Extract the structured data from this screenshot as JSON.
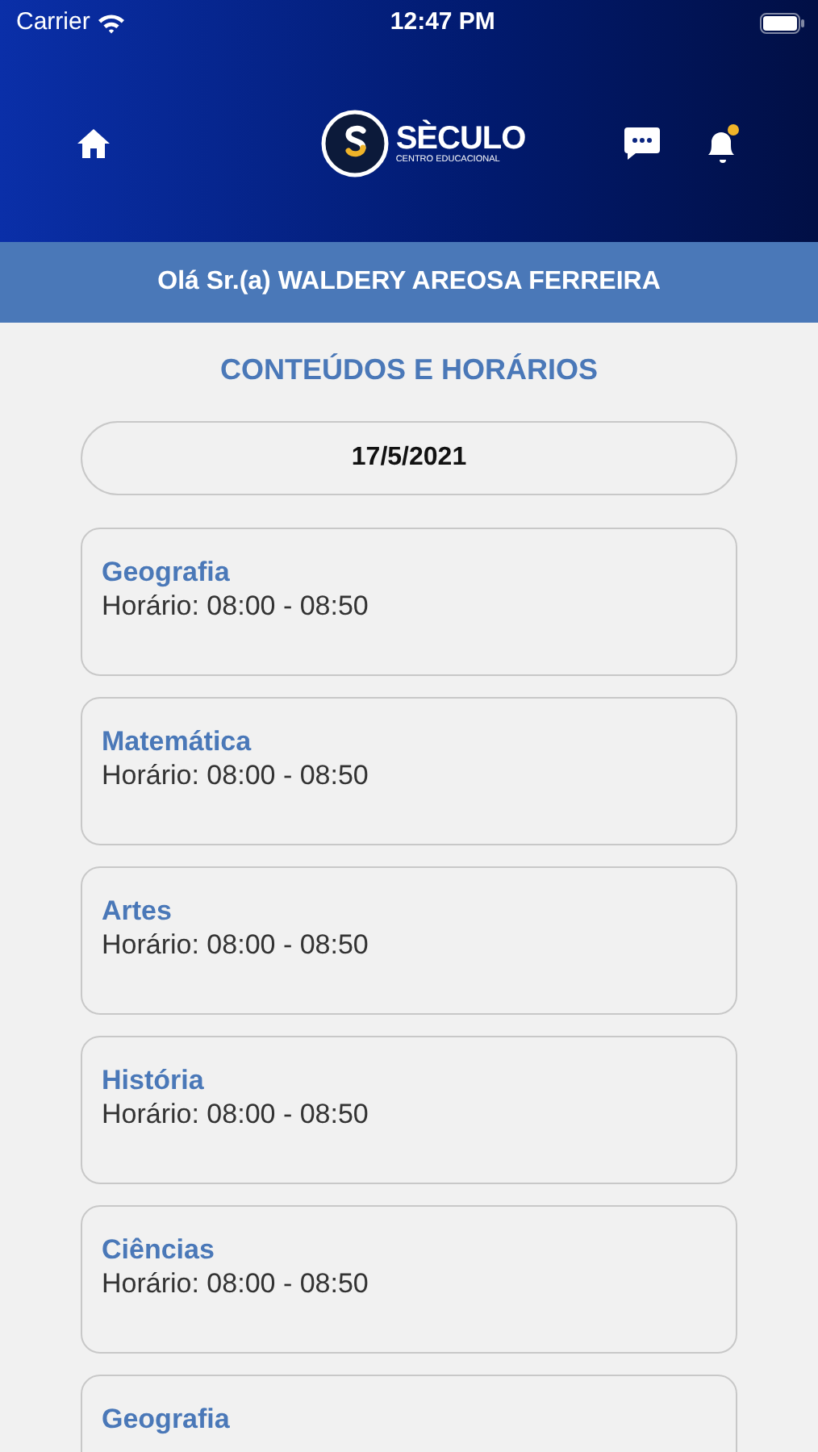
{
  "status_bar": {
    "carrier": "Carrier",
    "time": "12:47 PM"
  },
  "header": {
    "logo_title": "SÈCULO",
    "logo_subtitle": "CENTRO EDUCACIONAL",
    "notification_dot": true
  },
  "greeting": "Olá Sr.(a) WALDERY AREOSA FERREIRA",
  "page_title": "CONTEÚDOS E HORÁRIOS",
  "date": "17/5/2021",
  "classes": [
    {
      "subject": "Geografia",
      "schedule": "Horário: 08:00 - 08:50"
    },
    {
      "subject": "Matemática",
      "schedule": "Horário: 08:00 - 08:50"
    },
    {
      "subject": "Artes",
      "schedule": "Horário: 08:00 - 08:50"
    },
    {
      "subject": "História",
      "schedule": "Horário: 08:00 - 08:50"
    },
    {
      "subject": "Ciências",
      "schedule": "Horário: 08:00 - 08:50"
    },
    {
      "subject": "Geografia"
    }
  ]
}
